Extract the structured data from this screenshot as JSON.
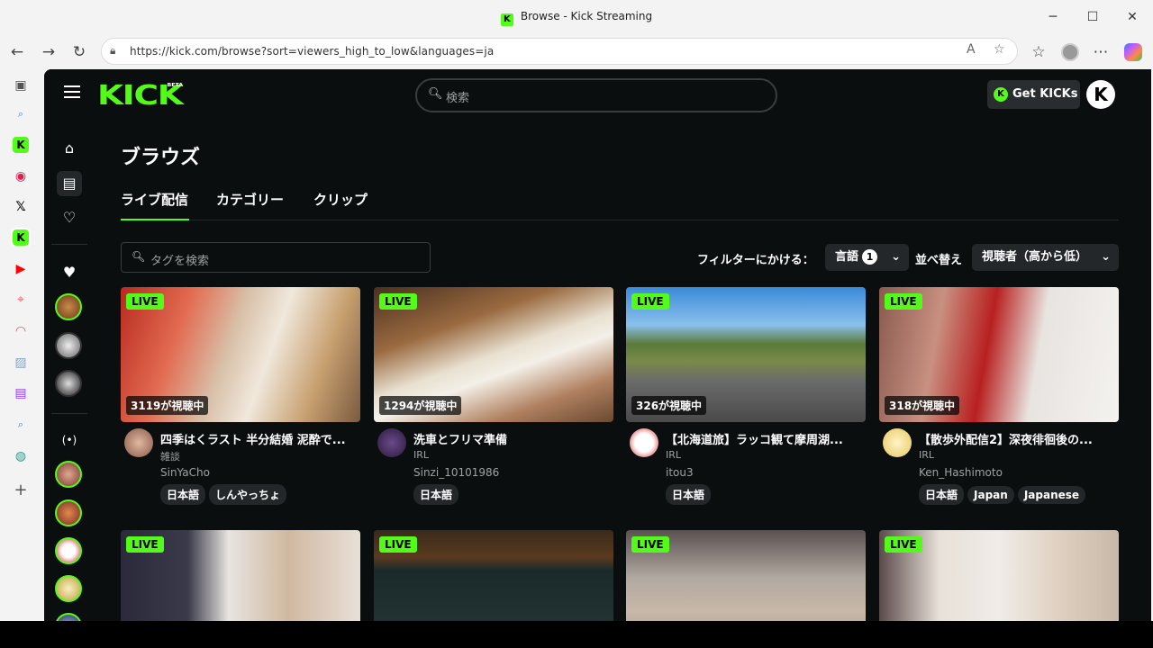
{
  "window": {
    "title": "Browse - Kick Streaming",
    "favicon": "K"
  },
  "browser": {
    "url": "https://kick.com/browse?sort=viewers_high_to_low&languages=ja"
  },
  "header": {
    "logo": "KICK",
    "logo_badge": "BETA",
    "search_placeholder": "検索",
    "get_kicks": "Get KICKs",
    "user_initial": "K"
  },
  "page_title": "ブラウズ",
  "tabs": [
    {
      "label": "ライブ配信",
      "active": true
    },
    {
      "label": "カテゴリー",
      "active": false
    },
    {
      "label": "クリップ",
      "active": false
    }
  ],
  "filters": {
    "tag_search_placeholder": "タグを検索",
    "filter_label": "フィルターにかける：",
    "language_label": "言語",
    "language_count": "1",
    "sort_label": "並べ替え",
    "sort_value": "視聴者（高から低）"
  },
  "live_label": "LIVE",
  "streams": [
    {
      "viewers": "3119が視聴中",
      "title": "四季はくラスト 半分結婚 泥酔で...",
      "category": "雑談",
      "user": "SinYaCho",
      "tags": [
        "日本語",
        "しんやっちょ"
      ]
    },
    {
      "viewers": "1294が視聴中",
      "title": "洗車とフリマ準備",
      "category": "IRL",
      "user": "Sinzi_10101986",
      "tags": [
        "日本語"
      ]
    },
    {
      "viewers": "326が視聴中",
      "title": "【北海道旅】ラッコ観て摩周湖...",
      "category": "IRL",
      "user": "itou3",
      "tags": [
        "日本語"
      ]
    },
    {
      "viewers": "318が視聴中",
      "title": "【散歩外配信2】深夜徘徊後の...",
      "category": "IRL",
      "user": "Ken_Hashimoto",
      "tags": [
        "日本語",
        "Japan",
        "Japanese"
      ]
    }
  ],
  "colors": {
    "accent": "#53fc18",
    "background": "#0b0e0f",
    "chip": "#24272a"
  }
}
